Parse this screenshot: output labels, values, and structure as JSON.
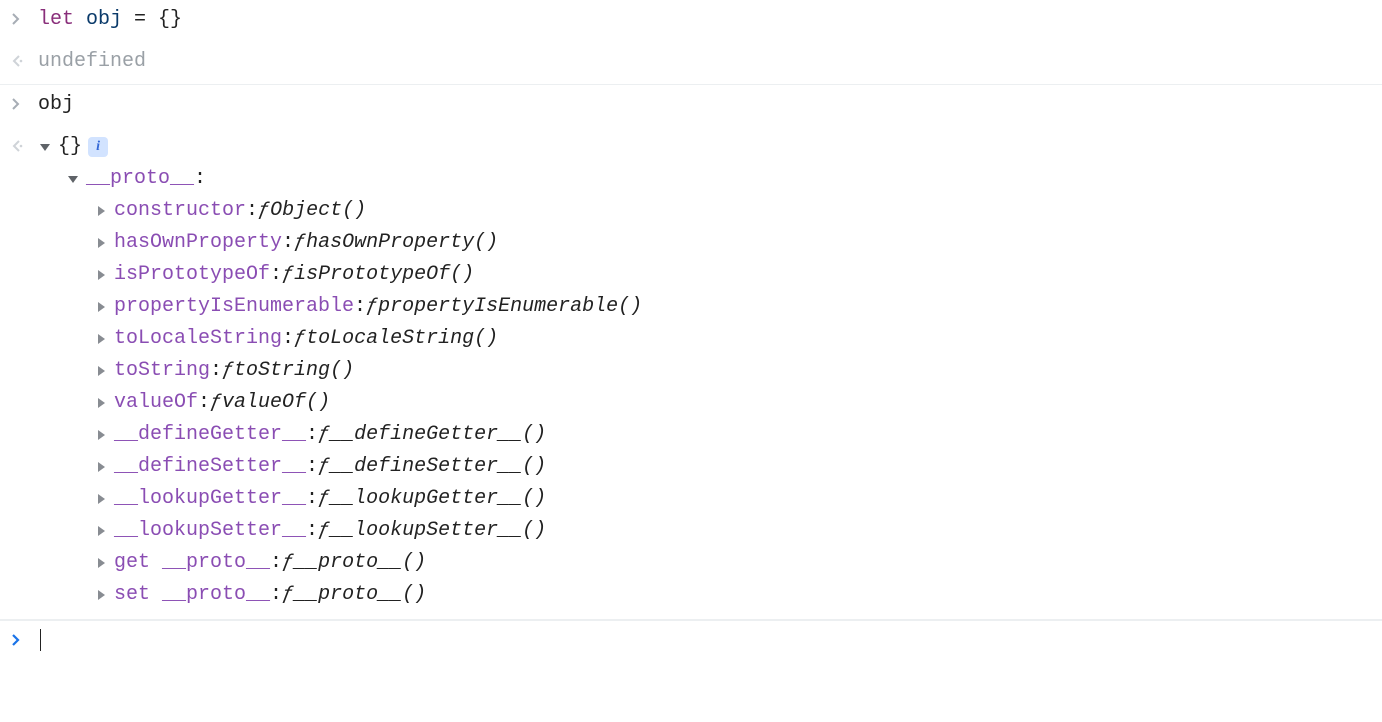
{
  "input1": {
    "keyword": "let",
    "varname": "obj",
    "rest": " = {}"
  },
  "output1": {
    "text": "undefined"
  },
  "input2": {
    "text": "obj"
  },
  "expanded": {
    "root_label": "{}",
    "proto_label": "__proto__",
    "members": [
      {
        "name": "constructor",
        "sig": "Object()"
      },
      {
        "name": "hasOwnProperty",
        "sig": "hasOwnProperty()"
      },
      {
        "name": "isPrototypeOf",
        "sig": "isPrototypeOf()"
      },
      {
        "name": "propertyIsEnumerable",
        "sig": "propertyIsEnumerable()"
      },
      {
        "name": "toLocaleString",
        "sig": "toLocaleString()"
      },
      {
        "name": "toString",
        "sig": "toString()"
      },
      {
        "name": "valueOf",
        "sig": "valueOf()"
      },
      {
        "name": "__defineGetter__",
        "sig": "__defineGetter__()"
      },
      {
        "name": "__defineSetter__",
        "sig": "__defineSetter__()"
      },
      {
        "name": "__lookupGetter__",
        "sig": "__lookupGetter__()"
      },
      {
        "name": "__lookupSetter__",
        "sig": "__lookupSetter__()"
      },
      {
        "name": "get __proto__",
        "sig": "__proto__()"
      },
      {
        "name": "set __proto__",
        "sig": "__proto__()"
      }
    ]
  },
  "f_symbol": "ƒ",
  "info_badge": "i",
  "colon": ":"
}
